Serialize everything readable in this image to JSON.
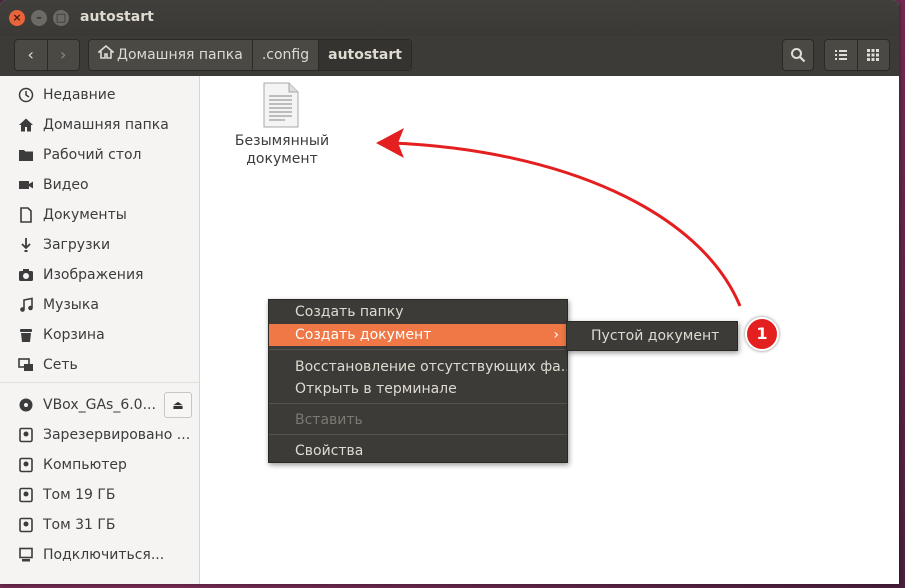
{
  "window": {
    "title": "autostart",
    "close_glyph": "×",
    "min_glyph": "–",
    "max_glyph": "□"
  },
  "toolbar": {
    "back_glyph": "‹",
    "forward_glyph": "›",
    "breadcrumbs": [
      {
        "label": "Домашняя папка",
        "icon": "home-icon"
      },
      {
        "label": ".config"
      },
      {
        "label": "autostart"
      }
    ],
    "search_icon": "search-icon",
    "list_view_icon": "list-view-icon",
    "grid_view_icon": "grid-view-icon"
  },
  "sidebar": {
    "items": [
      {
        "label": "Недавние",
        "icon": "clock-icon"
      },
      {
        "label": "Домашняя папка",
        "icon": "home-icon"
      },
      {
        "label": "Рабочий стол",
        "icon": "folder-icon"
      },
      {
        "label": "Видео",
        "icon": "video-icon"
      },
      {
        "label": "Документы",
        "icon": "document-icon"
      },
      {
        "label": "Загрузки",
        "icon": "download-icon"
      },
      {
        "label": "Изображения",
        "icon": "camera-icon"
      },
      {
        "label": "Музыка",
        "icon": "music-icon"
      },
      {
        "label": "Корзина",
        "icon": "trash-icon"
      },
      {
        "label": "Сеть",
        "icon": "network-icon"
      }
    ],
    "devices": [
      {
        "label": "VBox_GAs_6.0...",
        "icon": "disc-icon"
      },
      {
        "label": "Зарезервировано ...",
        "icon": "drive-icon"
      },
      {
        "label": "Компьютер",
        "icon": "drive-icon"
      },
      {
        "label": "Том 19 ГБ",
        "icon": "drive-icon"
      },
      {
        "label": "Том 31 ГБ",
        "icon": "drive-icon"
      },
      {
        "label": "Подключиться...",
        "icon": "server-icon"
      }
    ],
    "eject_glyph": "⏏"
  },
  "content": {
    "file": {
      "name": "Безымянный документ",
      "icon": "text-file-icon"
    }
  },
  "context_menu": {
    "items": [
      {
        "label": "Создать папку"
      },
      {
        "label": "Создать документ",
        "highlighted": true
      },
      {
        "label": "Восстановление отсутствующих фа..."
      },
      {
        "label": "Открыть в терминале"
      },
      {
        "label": "Вставить",
        "disabled": true
      },
      {
        "label": "Свойства"
      }
    ],
    "submenu_arrow": "›",
    "submenu": {
      "items": [
        {
          "label": "Пустой документ"
        }
      ]
    }
  },
  "annotation": {
    "badge_number": "1",
    "arrow_color": "#e41f1f"
  },
  "colors": {
    "accent": "#f07746",
    "titlebar": "#3c3b37",
    "close_button": "#e9633b"
  }
}
